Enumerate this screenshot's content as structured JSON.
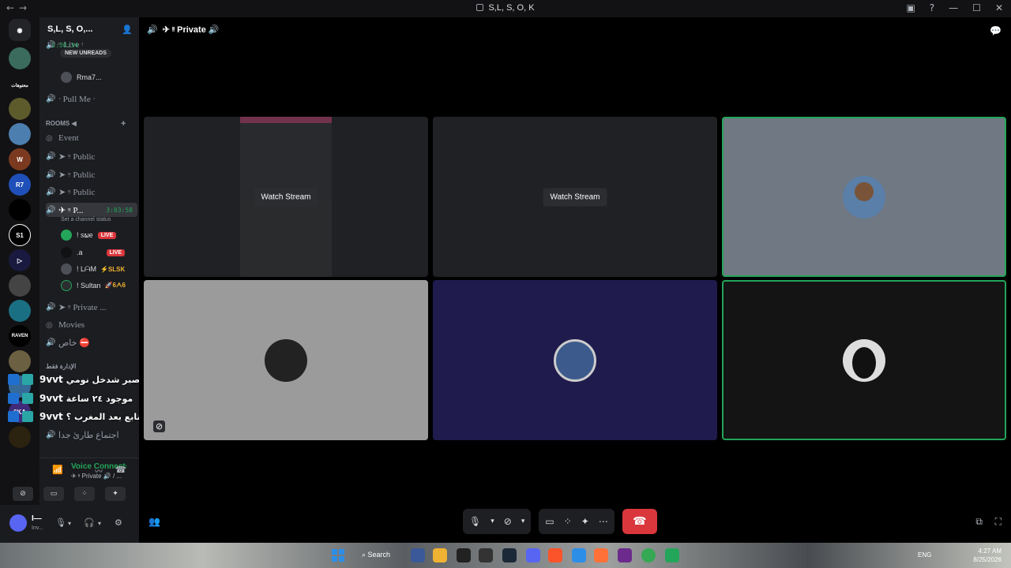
{
  "window": {
    "title": "S,L, S, O, K"
  },
  "server": {
    "name": "S,L, S, O,..."
  },
  "sidebar": {
    "new_unreads": "NEW UNREADS",
    "top_live_label": "ᵎᵎ Live ᵎ",
    "top_live_time": "1:30:34",
    "rma_member": "Rma7...",
    "pull_me": "ᐧ Pull Me ᐧ",
    "rooms_category": "ROOMS ◀",
    "channels": [
      {
        "label": "Event"
      },
      {
        "label": "➤ ᵎᵎ Public"
      },
      {
        "label": "➤ ᵎᵎ Public"
      },
      {
        "label": "➤ ᵎᵎ Public"
      }
    ],
    "active_channel": {
      "label": "✈ ᵎᵎ P...",
      "time": "3:03:58",
      "status_hint": "Set a channel status"
    },
    "members": [
      {
        "name": "! sພe",
        "tag": "LIVE",
        "color": "#23a55a"
      },
      {
        "name": ".a",
        "tag": "LIVE",
        "color": "#111214"
      },
      {
        "name": "! LᗩM",
        "tag": "⚡SLSK",
        "color": "#4e5058"
      },
      {
        "name": "! Sultan",
        "tag": "🚀6ᗅ6",
        "color": "#2b2d31"
      }
    ],
    "after_channels": [
      {
        "label": "➤ ᵎᵎ Private ..."
      },
      {
        "label": "Movies"
      },
      {
        "label": "خاص ⛔"
      }
    ],
    "admin_category": "الإدارة فقط",
    "bottom_channel": "اجتماع طارئ جدا"
  },
  "chat_overlay": [
    {
      "name": "9vvt",
      "message": "صبر صبر شدخل نومي"
    },
    {
      "name": "9vvt",
      "message": "موجود ٢٤ ساعة"
    },
    {
      "name": "9vvt",
      "message": "اتابع بعد المغرب ؟"
    }
  ],
  "voice_panel": {
    "title": "Voice Connected",
    "subtitle": "✈ ᵎᵎ Private 🔊 / ..."
  },
  "user": {
    "name": "I—",
    "status": "Inv..."
  },
  "stage": {
    "channel_title": "✈ ᵎᵎ Private 🔊",
    "watch_stream_label": "Watch Stream"
  },
  "taskbar": {
    "search": "Search",
    "lang": "ENG",
    "time": "4:27 AM",
    "date": "8/25/2026"
  },
  "guild_labels": {
    "text_server": "معتوهات",
    "r7": "R7",
    "raven": "RAVEN",
    "gka": "6KA"
  },
  "colors": {
    "accent_green": "#23a55a",
    "danger_red": "#da373c",
    "blurple": "#5865f2"
  }
}
